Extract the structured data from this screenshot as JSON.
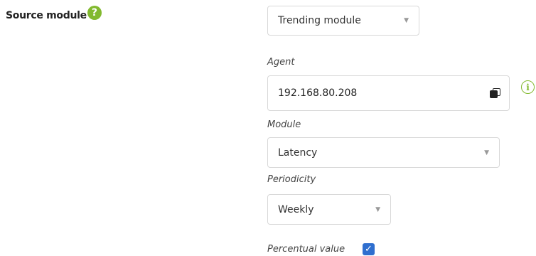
{
  "source_module": {
    "label": "Source module",
    "help_glyph": "?",
    "selected": "Trending module"
  },
  "agent": {
    "label": "Agent",
    "value": "192.168.80.208",
    "info_glyph": "i"
  },
  "module": {
    "label": "Module",
    "selected": "Latency"
  },
  "periodicity": {
    "label": "Periodicity",
    "selected": "Weekly"
  },
  "percentual": {
    "label": "Percentual value",
    "checked": true,
    "check_glyph": "✓"
  },
  "caret_glyph": "▼",
  "colors": {
    "accent_green": "#82b92e",
    "checkbox_blue": "#2f6fcf",
    "border": "#d8d8d8"
  }
}
